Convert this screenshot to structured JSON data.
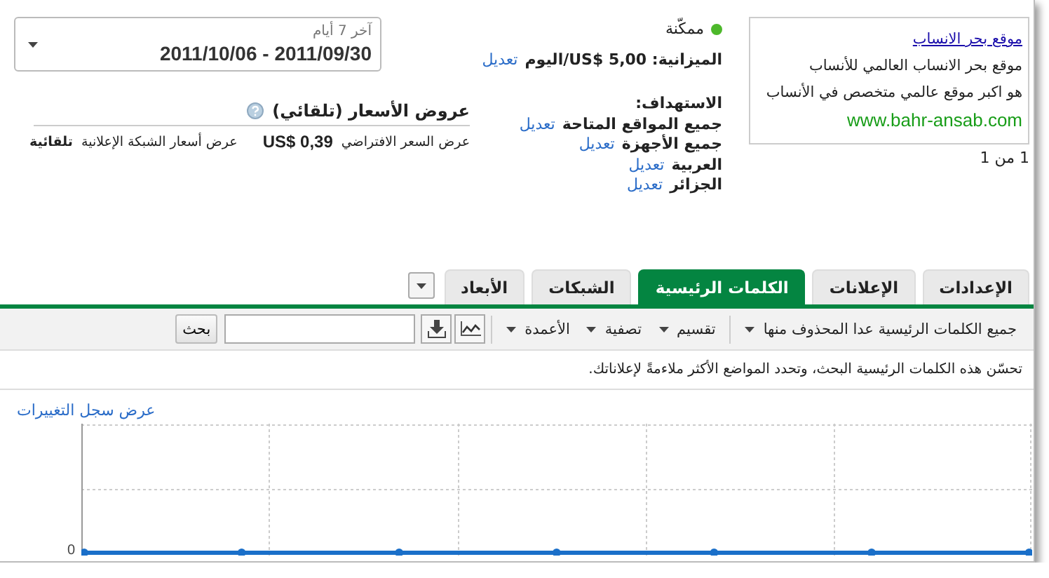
{
  "ad": {
    "headline": "موقع بحر الانساب",
    "lines": [
      "موقع بحر الانساب العالمي للأنساب",
      "هو اكبر موقع عالمي متخصص في الأنساب"
    ],
    "url": "www.bahr-ansab.com",
    "pager": "1 من 1"
  },
  "status": {
    "label": "ممكّنة",
    "enabled": true
  },
  "budget": {
    "label": "الميزانية:",
    "value": "US$ 5,00/اليوم",
    "edit": "تعديل"
  },
  "targeting": {
    "title": "الاستهداف:",
    "items": [
      {
        "label": "جميع المواقع المتاحة",
        "edit": "تعديل"
      },
      {
        "label": "جميع الأجهزة",
        "edit": "تعديل"
      },
      {
        "label": "العربية",
        "edit": "تعديل"
      },
      {
        "label": "الجزائر",
        "edit": "تعديل"
      }
    ]
  },
  "date_range": {
    "label": "آخر 7 أيام",
    "range": "2011/10/06 - 2011/09/30"
  },
  "bidding": {
    "title": "عروض الأسعار (تلقائي)",
    "default_label": "عرض السعر الافتراضي",
    "default_value": "US$ 0,39",
    "network_label": "عرض أسعار الشبكة الإعلانية",
    "network_value": "تلقائية"
  },
  "tabs": [
    {
      "label": "الإعدادات",
      "selected": false
    },
    {
      "label": "الإعلانات",
      "selected": false
    },
    {
      "label": "الكلمات الرئيسية",
      "selected": true
    },
    {
      "label": "الشبكات",
      "selected": false
    },
    {
      "label": "الأبعاد",
      "selected": false
    }
  ],
  "toolbar": {
    "filter": "جميع الكلمات الرئيسية عدا المحذوف منها",
    "menus": [
      "تقسيم",
      "تصفية",
      "الأعمدة"
    ],
    "search_button": "بحث"
  },
  "info": "تحسّن هذه الكلمات الرئيسية البحث، وتحدد المواضع الأكثر ملاءمةً لإعلاناتك.",
  "history_link": "عرض سجل التغييرات",
  "chart": {
    "y_label": "0"
  }
}
